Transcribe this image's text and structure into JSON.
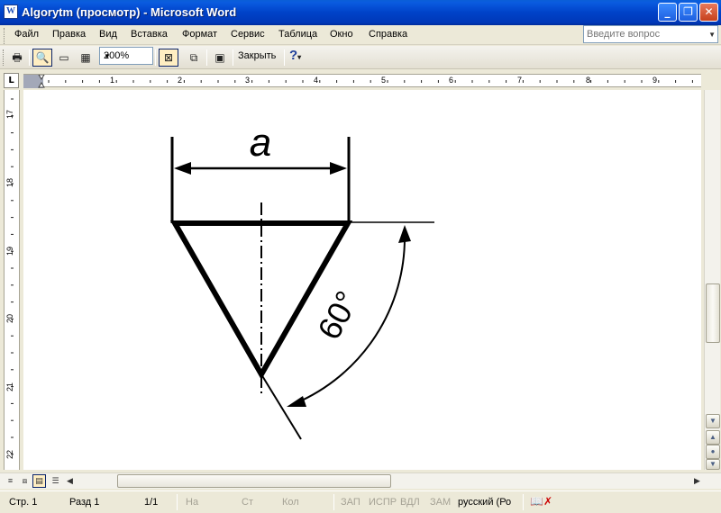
{
  "window": {
    "title": "Algorytm (просмотр) - Microsoft Word",
    "icon": "word-document-icon",
    "buttons": {
      "minimize": "_",
      "maximize": "❐",
      "close": "✕"
    }
  },
  "menu": {
    "items": [
      "Файл",
      "Правка",
      "Вид",
      "Вставка",
      "Формат",
      "Сервис",
      "Таблица",
      "Окно",
      "Справка"
    ],
    "help_placeholder": "Введите вопрос"
  },
  "toolbar": {
    "zoom": "200%",
    "close_label": "Закрыть"
  },
  "ruler": {
    "horizontal_ticks": [
      "1",
      "2",
      "3",
      "4",
      "5",
      "6",
      "7",
      "8",
      "9"
    ],
    "vertical_ticks": [
      "17",
      "18",
      "19",
      "20",
      "21",
      "22"
    ]
  },
  "drawing": {
    "dimension_label": "a",
    "angle_label": "60°"
  },
  "status": {
    "page": "Стр. 1",
    "section": "Разд 1",
    "pages": "1/1",
    "at": "На",
    "line": "Ст",
    "col": "Кол",
    "rec": "ЗАП",
    "trk": "ИСПР",
    "ext": "ВДЛ",
    "ovr": "ЗАМ",
    "language": "русский (Ро"
  }
}
